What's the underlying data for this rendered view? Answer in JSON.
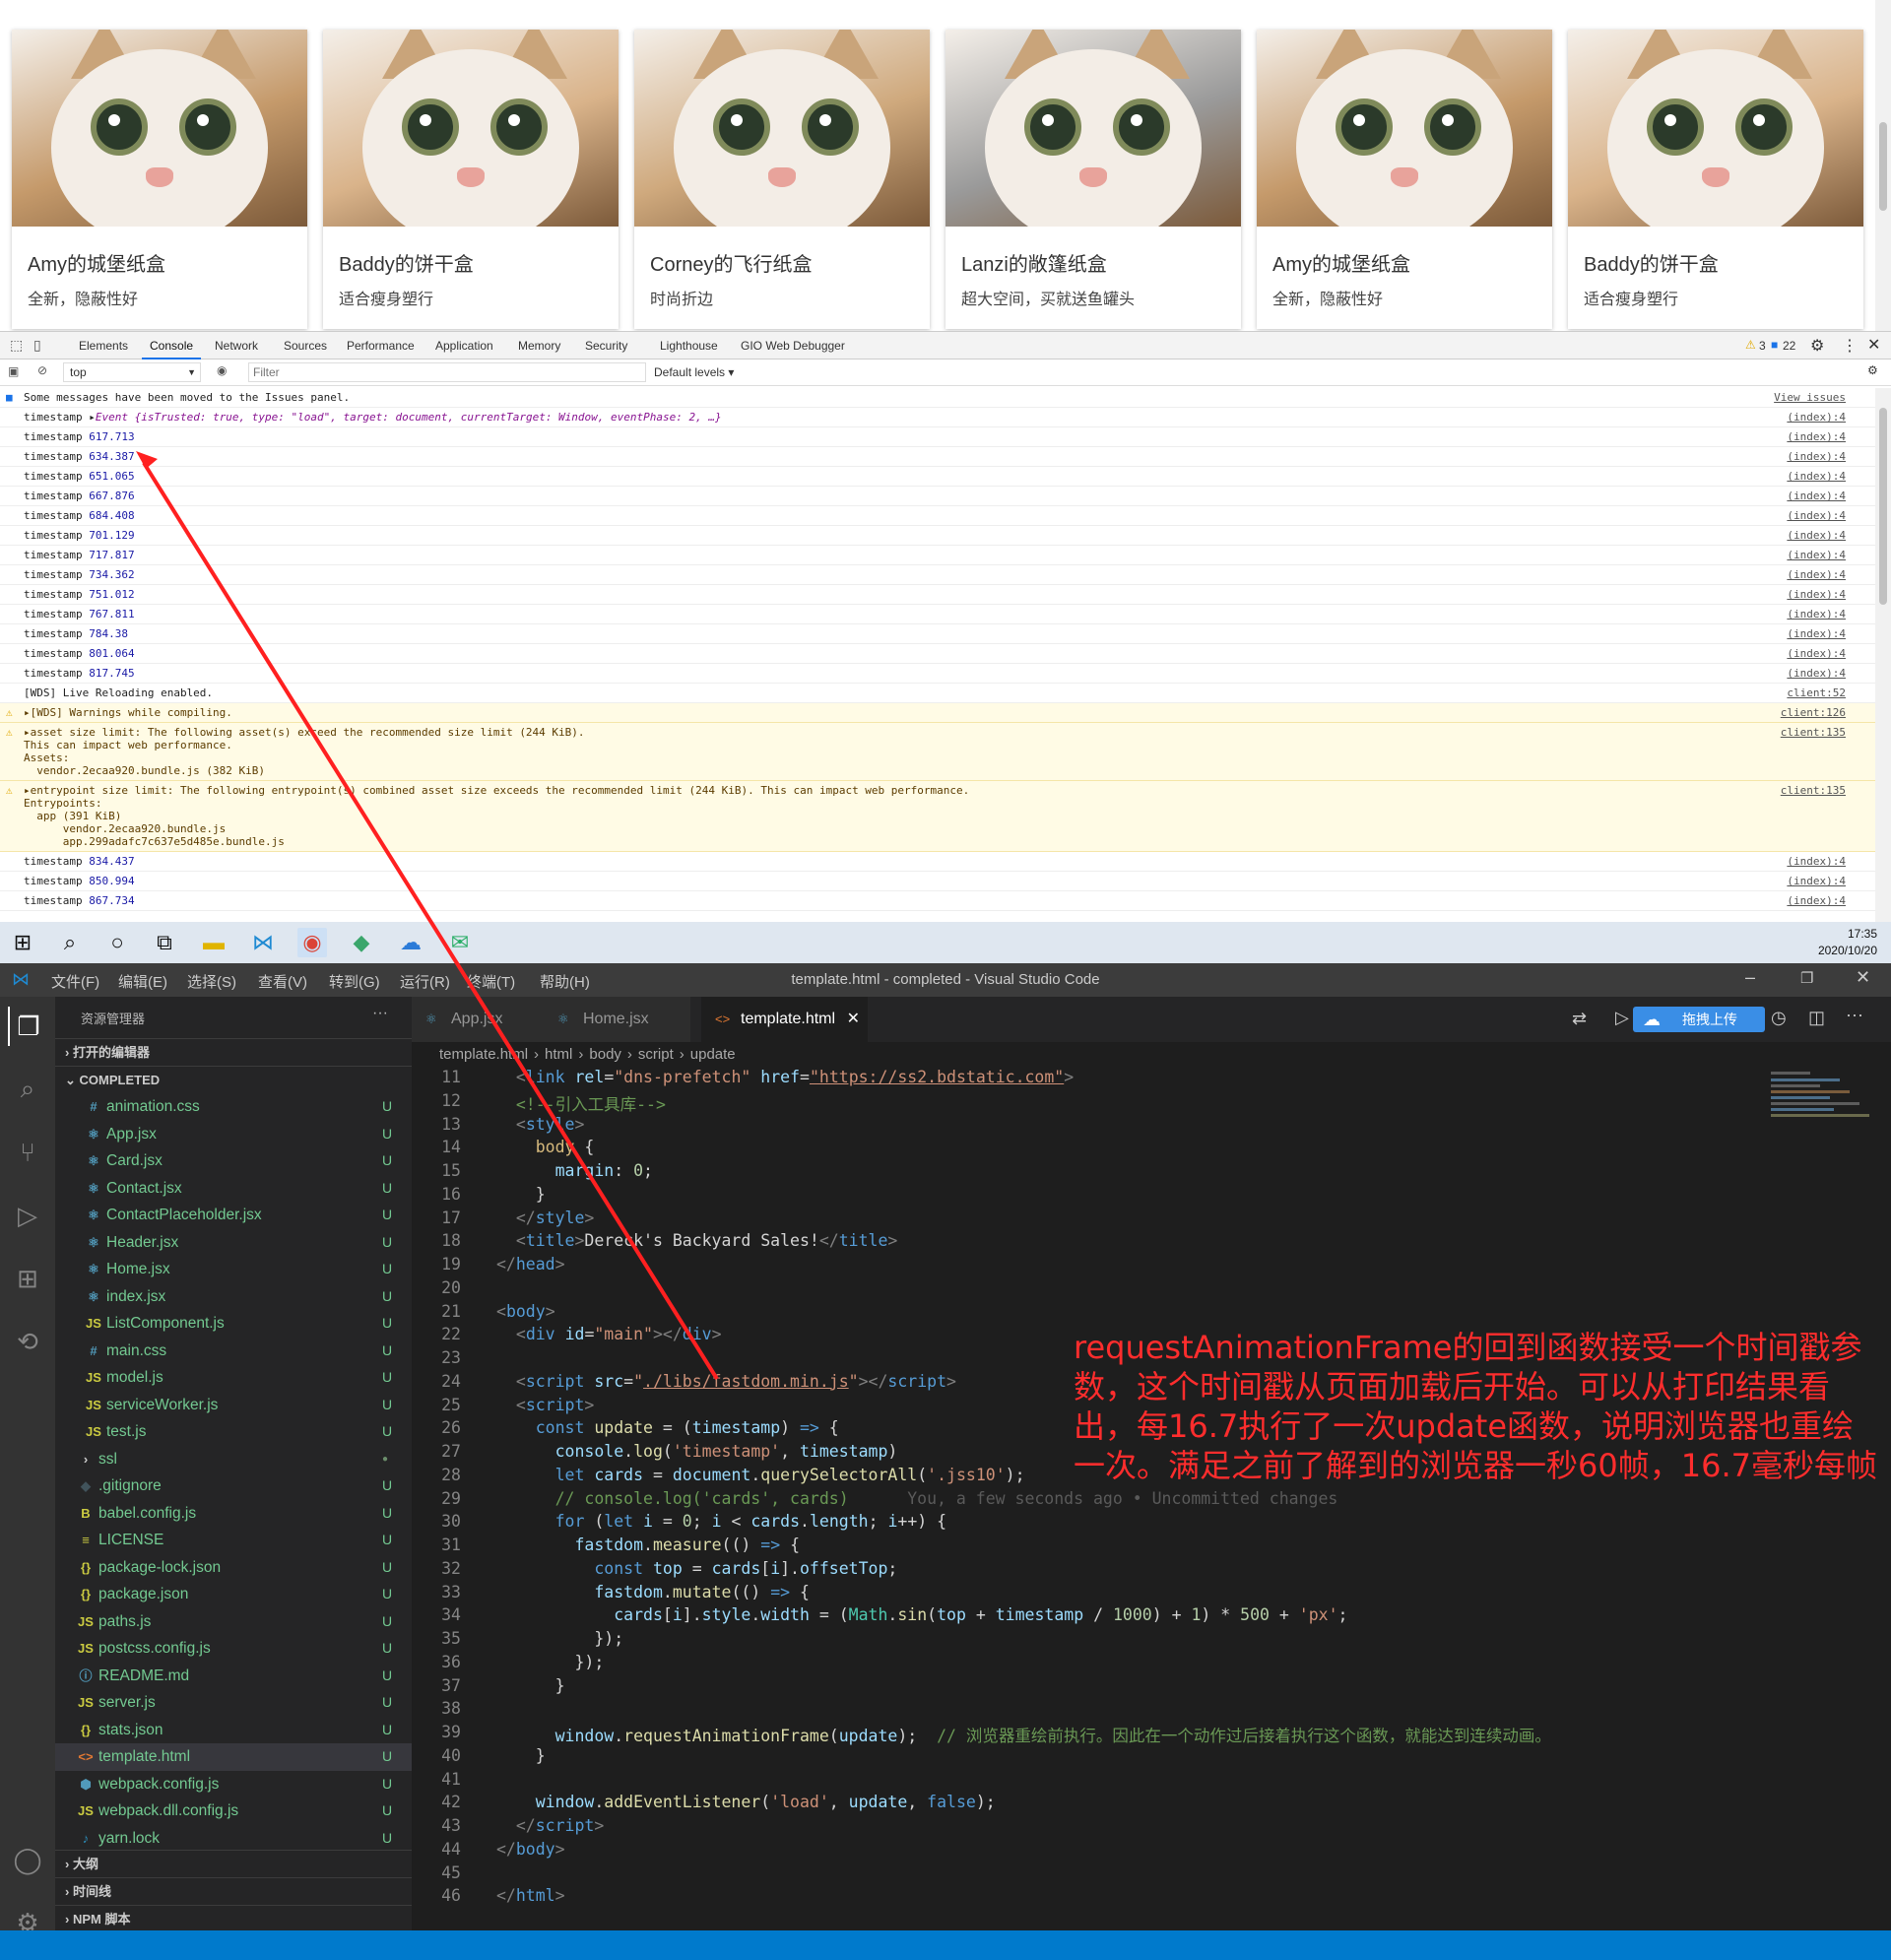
{
  "page": {
    "cards": [
      {
        "title": "Amy的城堡纸盒",
        "desc": "全新，隐蔽性好",
        "tone": "#c59a6b"
      },
      {
        "title": "Baddy的饼干盒",
        "desc": "适合瘦身塑行",
        "tone": "#d9b38a"
      },
      {
        "title": "Corney的飞行纸盒",
        "desc": "时尚折边",
        "tone": "#cfa97d"
      },
      {
        "title": "Lanzi的敞篷纸盒",
        "desc": "超大空间，买就送鱼罐头",
        "tone": "#9a9a9a"
      },
      {
        "title": "Amy的城堡纸盒",
        "desc": "全新，隐蔽性好",
        "tone": "#c59a6b"
      },
      {
        "title": "Baddy的饼干盒",
        "desc": "适合瘦身塑行",
        "tone": "#d9b38a"
      }
    ]
  },
  "devtools": {
    "tabs": [
      "Elements",
      "Console",
      "Network",
      "Sources",
      "Performance",
      "Application",
      "Memory",
      "Security",
      "Lighthouse",
      "GIO Web Debugger"
    ],
    "active_tab": "Console",
    "warn_count": "3",
    "msg_count": "22",
    "context": "top",
    "filter_placeholder": "Filter",
    "levels": "Default levels ▾",
    "issues_msg": "Some messages have been moved to the Issues panel.",
    "view_issues": "View issues",
    "event_prefix": "timestamp ▸",
    "event_obj": "Event {isTrusted: true, type: \"load\", target: document, currentTarget: Window, eventPhase: 2, …}",
    "event_src": "(index):4",
    "ts_label": "timestamp",
    "timestamps1": [
      "617.713",
      "634.387",
      "651.065",
      "667.876",
      "684.408",
      "701.129",
      "717.817",
      "734.362",
      "751.012",
      "767.811",
      "784.38",
      "801.064",
      "817.745"
    ],
    "timestamps2": [
      "834.437",
      "850.994",
      "867.734"
    ],
    "ts_src": "(index):4",
    "wds_live": "[WDS] Live Reloading enabled.",
    "wds_live_src": "client:52",
    "warn1": "▸[WDS] Warnings while compiling.",
    "warn1_src": "client:126",
    "warn2": "▸asset size limit: The following asset(s) exceed the recommended size limit (244 KiB).\nThis can impact web performance.\nAssets:\n  vendor.2ecaa920.bundle.js (382 KiB)",
    "warn2_src": "client:135",
    "warn3": "▸entrypoint size limit: The following entrypoint(s) combined asset size exceeds the recommended limit (244 KiB). This can impact web performance.\nEntrypoints:\n  app (391 KiB)\n      vendor.2ecaa920.bundle.js\n      app.299adafc7c637e5d485e.bundle.js",
    "warn3_src": "client:135"
  },
  "taskbar": {
    "time": "17:35",
    "date": "2020/10/20"
  },
  "vscode": {
    "menu": [
      "文件(F)",
      "编辑(E)",
      "选择(S)",
      "查看(V)",
      "转到(G)",
      "运行(R)",
      "终端(T)",
      "帮助(H)"
    ],
    "window_title": "template.html - completed - Visual Studio Code",
    "explorer_title": "资源管理器",
    "open_editors": "打开的编辑器",
    "project": "COMPLETED",
    "files": [
      {
        "icon": "#",
        "color": "#519aba",
        "name": "animation.css",
        "status": "U",
        "depth": 2
      },
      {
        "icon": "⚛",
        "color": "#519aba",
        "name": "App.jsx",
        "status": "U",
        "depth": 2
      },
      {
        "icon": "⚛",
        "color": "#519aba",
        "name": "Card.jsx",
        "status": "U",
        "depth": 2
      },
      {
        "icon": "⚛",
        "color": "#519aba",
        "name": "Contact.jsx",
        "status": "U",
        "depth": 2
      },
      {
        "icon": "⚛",
        "color": "#519aba",
        "name": "ContactPlaceholder.jsx",
        "status": "U",
        "depth": 2
      },
      {
        "icon": "⚛",
        "color": "#519aba",
        "name": "Header.jsx",
        "status": "U",
        "depth": 2
      },
      {
        "icon": "⚛",
        "color": "#519aba",
        "name": "Home.jsx",
        "status": "U",
        "depth": 2
      },
      {
        "icon": "⚛",
        "color": "#519aba",
        "name": "index.jsx",
        "status": "U",
        "depth": 2
      },
      {
        "icon": "JS",
        "color": "#cbcb41",
        "name": "ListComponent.js",
        "status": "U",
        "depth": 2
      },
      {
        "icon": "#",
        "color": "#519aba",
        "name": "main.css",
        "status": "U",
        "depth": 2
      },
      {
        "icon": "JS",
        "color": "#cbcb41",
        "name": "model.js",
        "status": "U",
        "depth": 2
      },
      {
        "icon": "JS",
        "color": "#cbcb41",
        "name": "serviceWorker.js",
        "status": "U",
        "depth": 2
      },
      {
        "icon": "JS",
        "color": "#cbcb41",
        "name": "test.js",
        "status": "U",
        "depth": 2
      },
      {
        "icon": "›",
        "color": "#cccccc",
        "name": "ssl",
        "status": "●",
        "depth": 1
      },
      {
        "icon": "◆",
        "color": "#41535b",
        "name": ".gitignore",
        "status": "U",
        "depth": 1
      },
      {
        "icon": "B",
        "color": "#cbcb41",
        "name": "babel.config.js",
        "status": "U",
        "depth": 1
      },
      {
        "icon": "≡",
        "color": "#cbcb41",
        "name": "LICENSE",
        "status": "U",
        "depth": 1
      },
      {
        "icon": "{}",
        "color": "#cbcb41",
        "name": "package-lock.json",
        "status": "U",
        "depth": 1
      },
      {
        "icon": "{}",
        "color": "#cbcb41",
        "name": "package.json",
        "status": "U",
        "depth": 1
      },
      {
        "icon": "JS",
        "color": "#cbcb41",
        "name": "paths.js",
        "status": "U",
        "depth": 1
      },
      {
        "icon": "JS",
        "color": "#cbcb41",
        "name": "postcss.config.js",
        "status": "U",
        "depth": 1
      },
      {
        "icon": "ⓘ",
        "color": "#519aba",
        "name": "README.md",
        "status": "U",
        "depth": 1
      },
      {
        "icon": "JS",
        "color": "#cbcb41",
        "name": "server.js",
        "status": "U",
        "depth": 1
      },
      {
        "icon": "{}",
        "color": "#cbcb41",
        "name": "stats.json",
        "status": "U",
        "depth": 1
      },
      {
        "icon": "<>",
        "color": "#e37933",
        "name": "template.html",
        "status": "U",
        "depth": 1,
        "selected": true
      },
      {
        "icon": "⬢",
        "color": "#519aba",
        "name": "webpack.config.js",
        "status": "U",
        "depth": 1
      },
      {
        "icon": "JS",
        "color": "#cbcb41",
        "name": "webpack.dll.config.js",
        "status": "U",
        "depth": 1
      },
      {
        "icon": "♪",
        "color": "#2c8ebb",
        "name": "yarn.lock",
        "status": "U",
        "depth": 1
      }
    ],
    "outline": "大纲",
    "timeline": "时间线",
    "npm": "NPM 脚本",
    "tabs": [
      {
        "label": "App.jsx",
        "icon": "⚛",
        "color": "#519aba"
      },
      {
        "label": "Home.jsx",
        "icon": "⚛",
        "color": "#519aba"
      },
      {
        "label": "template.html",
        "icon": "<>",
        "color": "#e37933",
        "active": true
      }
    ],
    "upload": "拖拽上传",
    "breadcrumbs": [
      "template.html",
      "html",
      "body",
      "script",
      "update"
    ],
    "blame": "You, a few seconds ago • Uncommitted changes",
    "line_numbers": [
      "11",
      "12",
      "13",
      "14",
      "15",
      "16",
      "17",
      "18",
      "19",
      "20",
      "21",
      "22",
      "23",
      "24",
      "25",
      "26",
      "27",
      "28",
      "29",
      "30",
      "31",
      "32",
      "33",
      "34",
      "35",
      "36",
      "37",
      "38",
      "39",
      "40",
      "41",
      "42",
      "43",
      "44",
      "45",
      "46"
    ]
  },
  "annotation": "requestAnimationFrame的回到函数接受一个时间戳参数，这个时间戳从页面加载后开始。可以从打印结果看出，每16.7执行了一次update函数，说明浏览器也重绘一次。满足之前了解到的浏览器一秒60帧，16.7毫秒每帧",
  "colors": {
    "accent": "#007acc",
    "annotation": "#ff2d2d",
    "devtools_tab": "#1a73e8"
  }
}
